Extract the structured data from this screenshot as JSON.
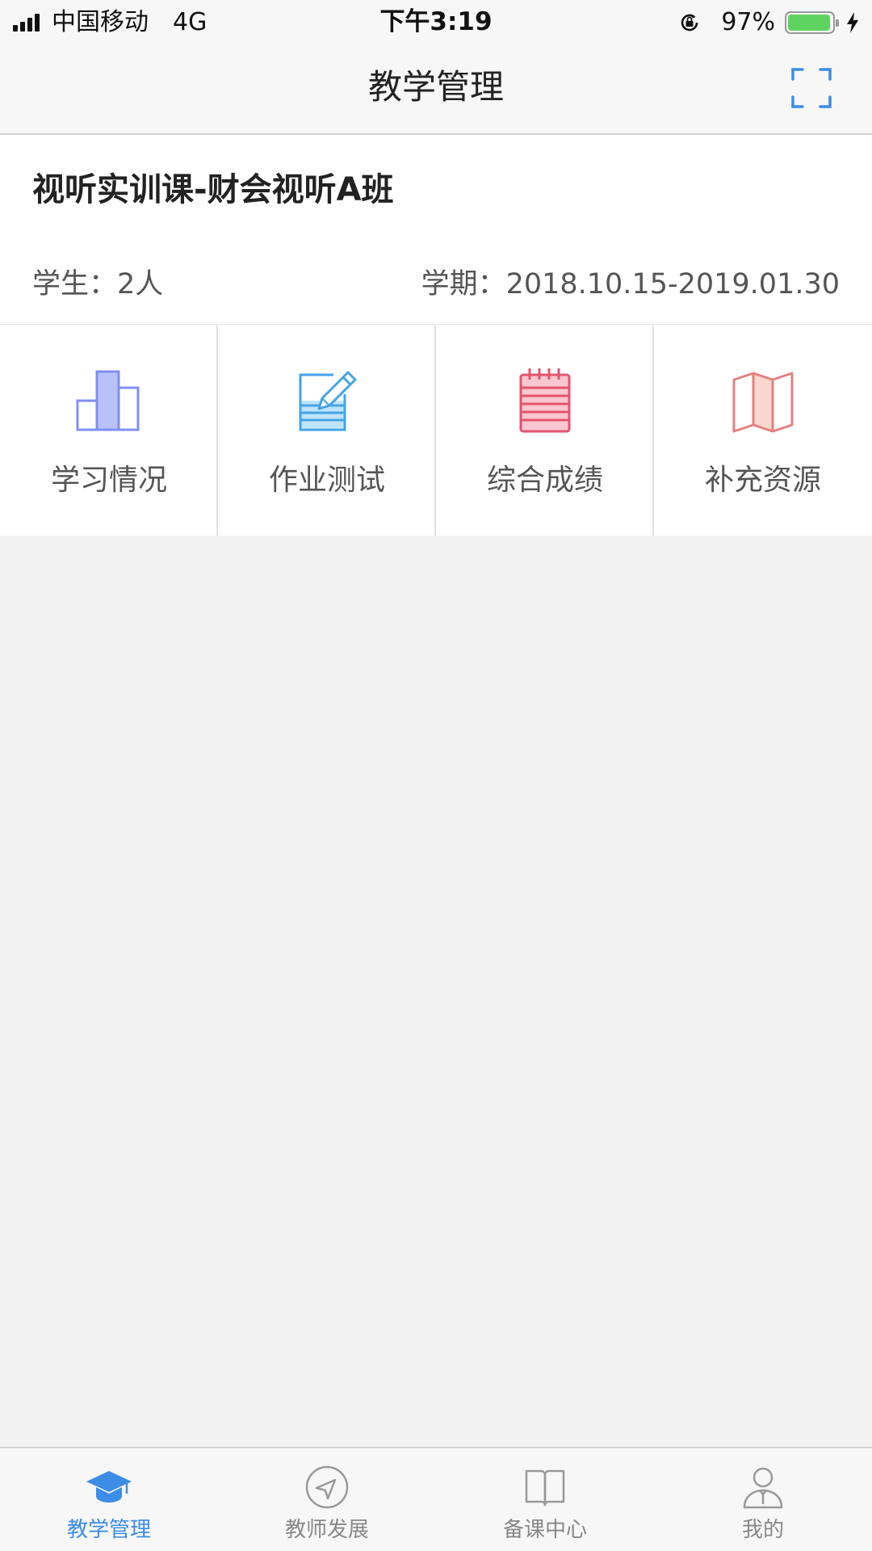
{
  "status_bar": {
    "carrier": "中国移动",
    "network": "4G",
    "time": "下午3:19",
    "battery": "97%",
    "battery_level": 0.97
  },
  "nav": {
    "title": "教学管理"
  },
  "course": {
    "title": "视听实训课-财会视听A班",
    "students": "学生：2人",
    "term": "学期：2018.10.15-2019.01.30"
  },
  "functions": [
    {
      "label": "学习情况",
      "icon": "bar-chart-icon"
    },
    {
      "label": "作业测试",
      "icon": "notepad-pencil-icon"
    },
    {
      "label": "综合成绩",
      "icon": "spiral-notebook-icon"
    },
    {
      "label": "补充资源",
      "icon": "folded-map-icon"
    }
  ],
  "tabs": [
    {
      "label": "教学管理",
      "icon": "graduation-cap-icon",
      "active": true
    },
    {
      "label": "教师发展",
      "icon": "compass-arrow-icon",
      "active": false
    },
    {
      "label": "备课中心",
      "icon": "open-book-icon",
      "active": false
    },
    {
      "label": "我的",
      "icon": "user-profile-icon",
      "active": false
    }
  ],
  "colors": {
    "accent": "#3b8de6",
    "chart_icon": "#7f8ff0",
    "notepad_icon": "#45a3e6",
    "notebook_icon": "#e4546e",
    "map_icon": "#e48080"
  }
}
